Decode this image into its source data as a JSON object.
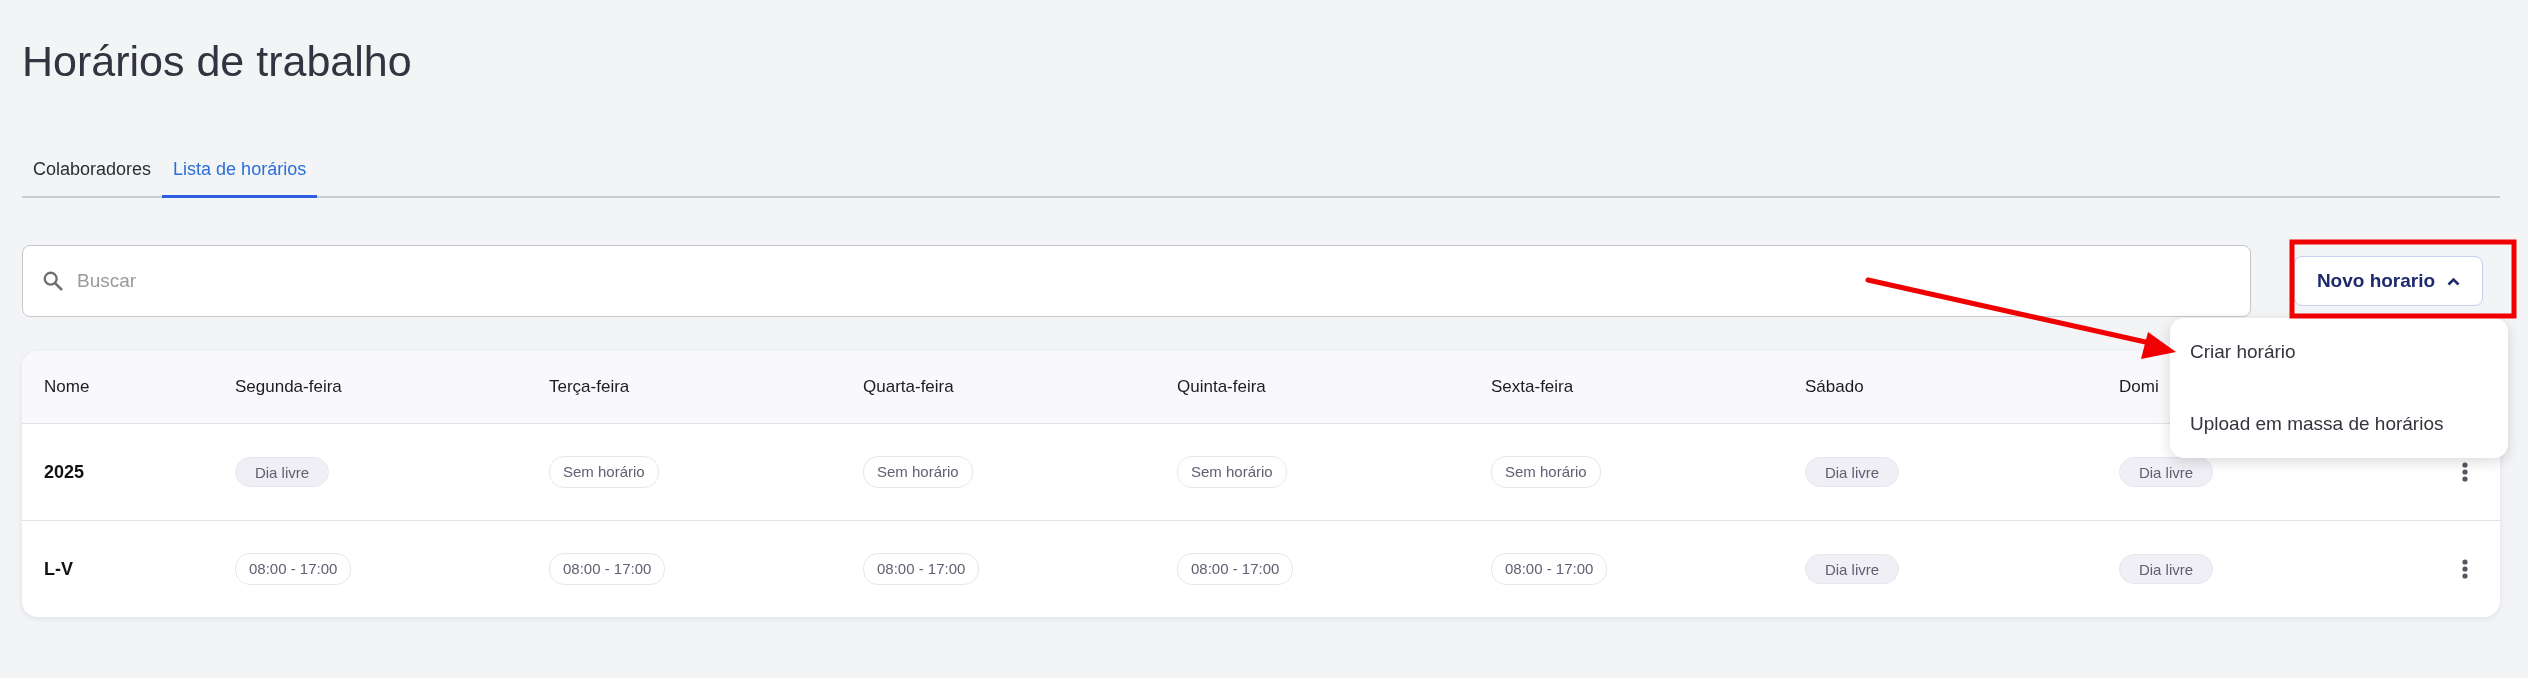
{
  "page": {
    "title": "Horários de trabalho"
  },
  "tabs": [
    {
      "label": "Colaboradores",
      "selected": false
    },
    {
      "label": "Lista de horários",
      "selected": true
    }
  ],
  "search": {
    "placeholder": "Buscar"
  },
  "new_button": {
    "label": "Novo horario",
    "expanded": true
  },
  "menu": {
    "items": [
      "Criar horário",
      "Upload em massa de horários"
    ]
  },
  "table": {
    "columns": [
      "Nome",
      "Segunda-feira",
      "Terça-feira",
      "Quarta-feira",
      "Quinta-feira",
      "Sexta-feira",
      "Sábado",
      "Domi"
    ],
    "rows": [
      {
        "cells": [
          {
            "text": "2025",
            "kind": "name"
          },
          {
            "text": "Dia livre",
            "kind": "off"
          },
          {
            "text": "Sem horário",
            "kind": "outline"
          },
          {
            "text": "Sem horário",
            "kind": "outline"
          },
          {
            "text": "Sem horário",
            "kind": "outline"
          },
          {
            "text": "Sem horário",
            "kind": "outline"
          },
          {
            "text": "Dia livre",
            "kind": "off"
          },
          {
            "text": "Dia livre",
            "kind": "off"
          }
        ]
      },
      {
        "cells": [
          {
            "text": "L-V",
            "kind": "name"
          },
          {
            "text": "08:00 - 17:00",
            "kind": "outline"
          },
          {
            "text": "08:00 - 17:00",
            "kind": "outline"
          },
          {
            "text": "08:00 - 17:00",
            "kind": "outline"
          },
          {
            "text": "08:00 - 17:00",
            "kind": "outline"
          },
          {
            "text": "08:00 - 17:00",
            "kind": "outline"
          },
          {
            "text": "Dia livre",
            "kind": "off"
          },
          {
            "text": "Dia livre",
            "kind": "off"
          }
        ]
      }
    ]
  }
}
